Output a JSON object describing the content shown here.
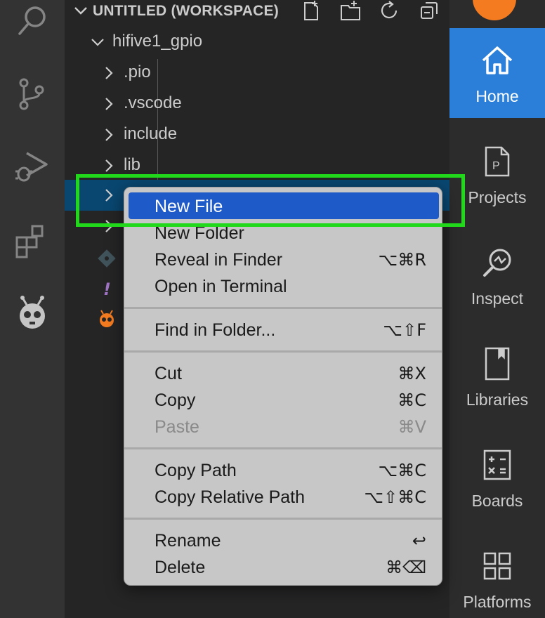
{
  "activity_bar": {
    "icons": [
      "search-icon",
      "source-control-icon",
      "run-debug-icon",
      "extensions-icon",
      "platformio-icon"
    ]
  },
  "explorer": {
    "workspace_title": "UNTITLED (WORKSPACE)",
    "project": "hifive1_gpio",
    "folders": [
      ".pio",
      ".vscode",
      "include",
      "lib"
    ],
    "file_icons": [
      "git-file-icon",
      "yaml-file-icon",
      "platformio-file-icon"
    ],
    "header_actions": [
      "new-file-icon",
      "new-folder-icon",
      "refresh-icon",
      "collapse-all-icon"
    ]
  },
  "context_menu": {
    "groups": [
      [
        {
          "label": "New File",
          "shortcut": "",
          "state": "highlighted"
        },
        {
          "label": "New Folder",
          "shortcut": "",
          "state": "normal"
        },
        {
          "label": "Reveal in Finder",
          "shortcut": "⌥⌘R",
          "state": "normal"
        },
        {
          "label": "Open in Terminal",
          "shortcut": "",
          "state": "normal"
        }
      ],
      [
        {
          "label": "Find in Folder...",
          "shortcut": "⌥⇧F",
          "state": "normal"
        }
      ],
      [
        {
          "label": "Cut",
          "shortcut": "⌘X",
          "state": "normal"
        },
        {
          "label": "Copy",
          "shortcut": "⌘C",
          "state": "normal"
        },
        {
          "label": "Paste",
          "shortcut": "⌘V",
          "state": "disabled"
        }
      ],
      [
        {
          "label": "Copy Path",
          "shortcut": "⌥⌘C",
          "state": "normal"
        },
        {
          "label": "Copy Relative Path",
          "shortcut": "⌥⇧⌘C",
          "state": "normal"
        }
      ],
      [
        {
          "label": "Rename",
          "shortcut": "↩",
          "state": "normal"
        },
        {
          "label": "Delete",
          "shortcut": "⌘⌫",
          "state": "normal"
        }
      ]
    ]
  },
  "pio_panel": {
    "items": [
      {
        "label": "Home",
        "icon": "home-icon",
        "active": true
      },
      {
        "label": "Projects",
        "icon": "projects-icon",
        "active": false
      },
      {
        "label": "Inspect",
        "icon": "inspect-icon",
        "active": false
      },
      {
        "label": "Libraries",
        "icon": "libraries-icon",
        "active": false
      },
      {
        "label": "Boards",
        "icon": "boards-icon",
        "active": false
      },
      {
        "label": "Platforms",
        "icon": "platforms-icon",
        "active": false
      }
    ]
  },
  "colors": {
    "highlight_box": "#22d81a",
    "menu_highlight": "#1e5ac8",
    "pio_active": "#2b7fd8",
    "pio_orange": "#f47b20"
  }
}
